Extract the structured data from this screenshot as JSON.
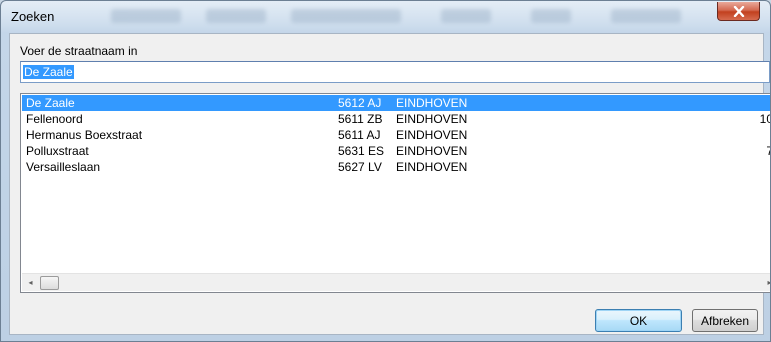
{
  "window": {
    "title": "Zoeken",
    "close_icon": "close-icon"
  },
  "form": {
    "prompt_label": "Voer de straatnaam in",
    "street_input_value": "De Zaale"
  },
  "results": {
    "rows": [
      {
        "street": "De Zaale",
        "zip": "5612 AJ",
        "city": "EINDHOVEN",
        "num": "",
        "selected": true
      },
      {
        "street": "Fellenoord",
        "zip": "5611 ZB",
        "city": "EINDHOVEN",
        "num": "10",
        "selected": false
      },
      {
        "street": "Hermanus Boexstraat",
        "zip": "5611 AJ",
        "city": "EINDHOVEN",
        "num": "",
        "selected": false
      },
      {
        "street": "Polluxstraat",
        "zip": "5631 ES",
        "city": "EINDHOVEN",
        "num": "7",
        "selected": false
      },
      {
        "street": "Versailleslaan",
        "zip": "5627 LV",
        "city": "EINDHOVEN",
        "num": "",
        "selected": false
      }
    ],
    "scroll_left_glyph": "◂",
    "scroll_right_glyph": "▸"
  },
  "buttons": {
    "ok_label": "OK",
    "cancel_label": "Afbreken"
  },
  "colors": {
    "selection": "#3399ff",
    "close_button": "#c2401f"
  }
}
